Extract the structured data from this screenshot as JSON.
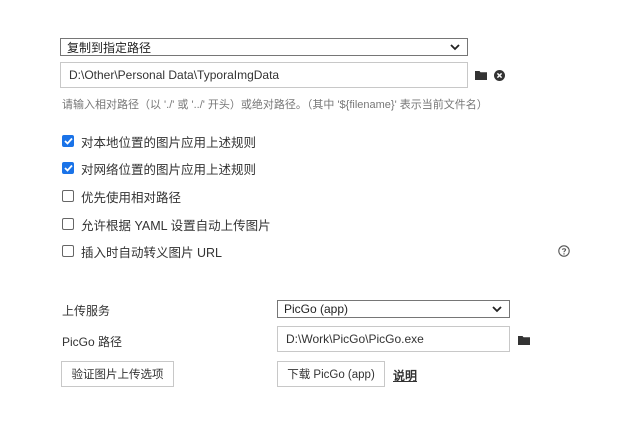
{
  "image_section": {
    "action_select": {
      "value": "复制到指定路径"
    },
    "path_input": {
      "value": "D:\\Other\\Personal Data\\TyporaImgData"
    },
    "path_hint": "请输入相对路径（以 './' 或 '../' 开头）或绝对路径。（其中 '${filename}' 表示当前文件名）",
    "checkboxes": [
      {
        "label": "对本地位置的图片应用上述规则",
        "checked": true
      },
      {
        "label": "对网络位置的图片应用上述规则",
        "checked": true
      },
      {
        "label": "优先使用相对路径",
        "checked": false
      },
      {
        "label": "允许根据 YAML 设置自动上传图片",
        "checked": false
      },
      {
        "label": "插入时自动转义图片 URL",
        "checked": false
      }
    ]
  },
  "upload_section": {
    "service_label": "上传服务",
    "service_select": {
      "value": "PicGo (app)"
    },
    "picgo_path_label": "PicGo 路径",
    "picgo_path_input": {
      "value": "D:\\Work\\PicGo\\PicGo.exe"
    },
    "validate_button": "验证图片上传选项",
    "download_button": "下载 PicGo (app)",
    "help_link": "说明"
  },
  "colors": {
    "checkbox_accent": "#1a73e8",
    "text": "#333333",
    "hint": "#777777"
  },
  "icons": [
    "chevron-down-icon",
    "folder-icon",
    "close-circle-icon",
    "help-circle-icon",
    "check-icon"
  ]
}
